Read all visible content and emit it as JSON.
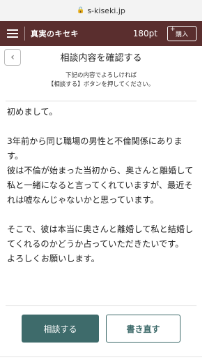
{
  "browser": {
    "url": "s-kiseki.jp"
  },
  "header": {
    "logo": "真実のキセキ",
    "points": "180pt",
    "buy_label": "購入",
    "buy_plus": "+"
  },
  "page": {
    "title": "相談内容を確認する",
    "instruction_line1": "下記の内容でよろしければ",
    "instruction_line2": "【相談する】ボタンを押してください。"
  },
  "consultation": {
    "text": "初めまして。\n\n3年前から同じ職場の男性と不倫関係にあります。\n彼は不倫が始まった当初から、奥さんと離婚して私と一緒になると言ってくれていますが、最近それは嘘なんじゃないかと思っています。\n\nそこで、彼は本当に奥さんと離婚して私と結婚してくれるのかどうか占っていただきたいです。\nよろしくお願いします。"
  },
  "actions": {
    "consult_label": "相談する",
    "rewrite_label": "書き直す"
  },
  "colors": {
    "header_bg": "#5a2e2e",
    "primary": "#3e6b6b"
  },
  "icons": {
    "menu": "hamburger-menu-icon",
    "back": "chevron-left-icon",
    "lock": "lock-icon"
  }
}
